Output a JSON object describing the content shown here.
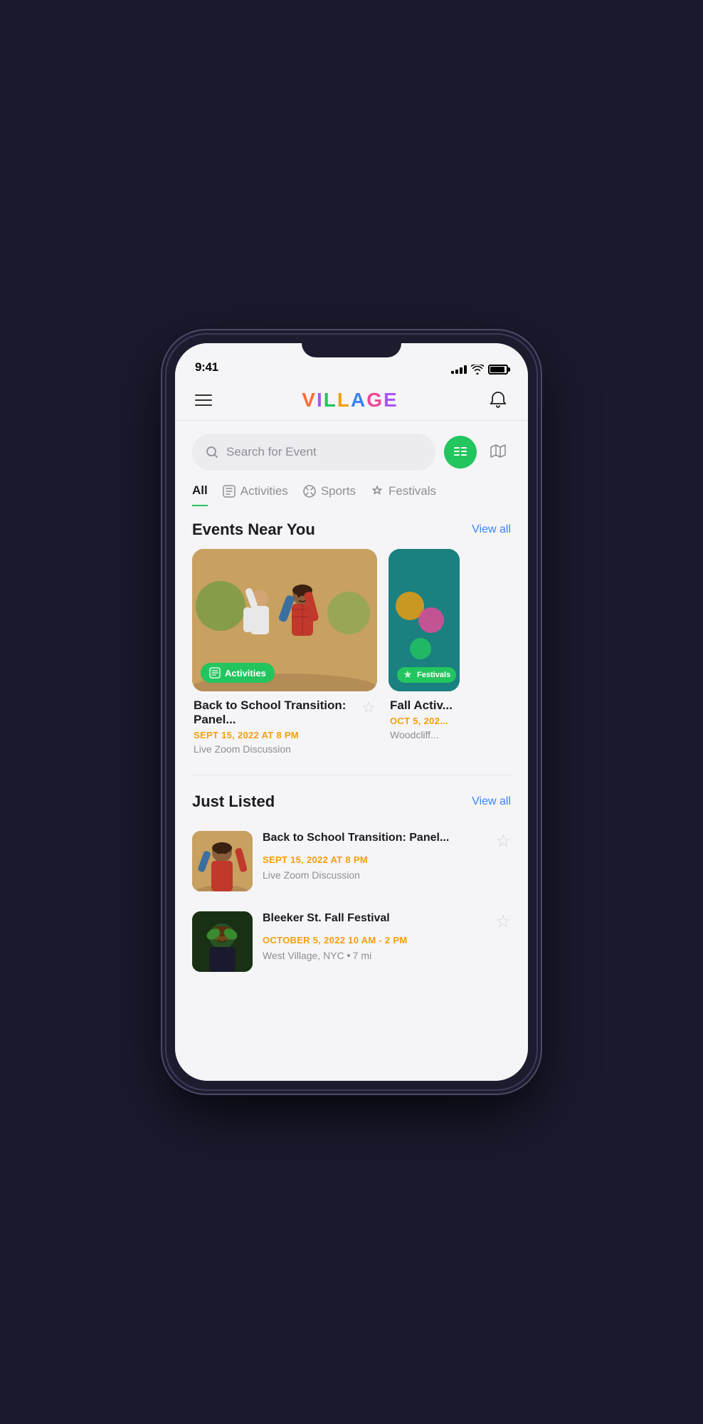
{
  "status": {
    "time": "9:41",
    "signal": [
      3,
      5,
      7,
      9
    ],
    "wifi": true,
    "battery": 90
  },
  "header": {
    "logo_letters": [
      "V",
      "I",
      "L",
      "L",
      "A",
      "G",
      "E"
    ],
    "logo_colors": [
      "#ff6b35",
      "#a855f7",
      "#22c55e",
      "#f59e0b",
      "#3b82f6",
      "#ec4899",
      "#a855f7"
    ],
    "menu_label": "Menu",
    "notification_label": "Notifications"
  },
  "search": {
    "placeholder": "Search for Event",
    "list_view_label": "List view",
    "map_view_label": "Map view"
  },
  "categories": [
    {
      "id": "all",
      "label": "All",
      "icon": "",
      "active": true
    },
    {
      "id": "activities",
      "label": "Activities",
      "icon": "🗂",
      "active": false
    },
    {
      "id": "sports",
      "label": "Sports",
      "icon": "⚽",
      "active": false
    },
    {
      "id": "festivals",
      "label": "Festivals",
      "icon": "🎉",
      "active": false
    }
  ],
  "events_near_you": {
    "section_title": "Events Near You",
    "view_all_label": "View all",
    "events": [
      {
        "id": "event-1",
        "title": "Back to School Transition: Panel...",
        "date": "SEPT 15, 2022 AT 8 PM",
        "location": "Live Zoom Discussion",
        "badge": "Activities",
        "badge_color": "#22c55e",
        "star": false
      },
      {
        "id": "event-2",
        "title": "Fall Activ...",
        "date": "OCT 5, 202...",
        "location": "Woodcliff...",
        "badge": "Festivals",
        "badge_color": "#22c55e",
        "star": false
      }
    ]
  },
  "just_listed": {
    "section_title": "Just Listed",
    "view_all_label": "View all",
    "items": [
      {
        "id": "listed-1",
        "title": "Back to School Transition: Panel...",
        "date": "SEPT 15, 2022 AT 8 PM",
        "location": "Live Zoom Discussion",
        "star": false
      },
      {
        "id": "listed-2",
        "title": "Bleeker St. Fall Festival",
        "date": "OCTOBER 5, 2022 10 AM - 2 PM",
        "location": "West Village, NYC",
        "distance": "7 mi",
        "star": false
      }
    ]
  }
}
